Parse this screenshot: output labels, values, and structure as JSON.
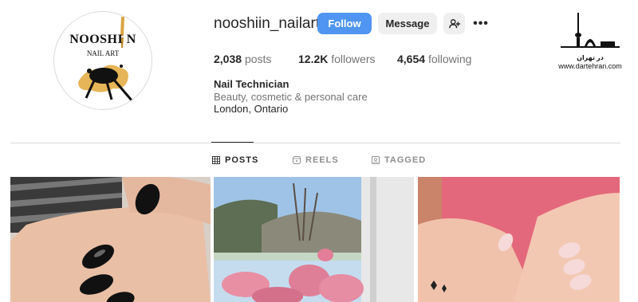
{
  "profile": {
    "avatar": {
      "brand": "NOOSHI N",
      "sub": "NAIL ART"
    },
    "username": "nooshiin_nailart",
    "buttons": {
      "follow": "Follow",
      "message": "Message",
      "more": "•••"
    },
    "stats": [
      {
        "value": "2,038",
        "label": "posts"
      },
      {
        "value": "12.2K",
        "label": "followers"
      },
      {
        "value": "4,654",
        "label": "following"
      }
    ],
    "bio": {
      "name": "Nail Technician",
      "category": "Beauty, cosmetic & personal care",
      "location": "London, Ontario"
    }
  },
  "watermark": {
    "fa": "در تهران",
    "site": "www.dartehran.com"
  },
  "tabs": [
    {
      "label": "POSTS",
      "icon": "grid-icon",
      "active": true
    },
    {
      "label": "REELS",
      "icon": "reels-icon",
      "active": false
    },
    {
      "label": "TAGGED",
      "icon": "tagged-icon",
      "active": false
    }
  ],
  "colors": {
    "accent": "#4f95f1",
    "muted": "#737373",
    "border": "#dbdbdb"
  }
}
